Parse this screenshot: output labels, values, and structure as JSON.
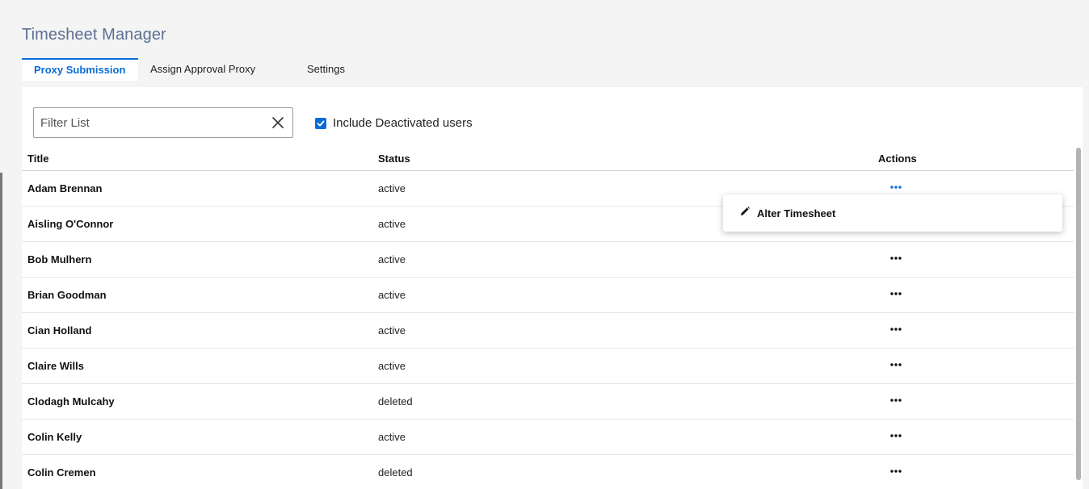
{
  "app": {
    "title": "Timesheet Manager"
  },
  "tabs": [
    {
      "label": "Proxy Submission",
      "active": true
    },
    {
      "label": "Assign Approval Proxy",
      "active": false
    },
    {
      "label": "Settings",
      "active": false
    }
  ],
  "filter": {
    "placeholder": "Filter List",
    "value": "",
    "clear_icon": "close-icon"
  },
  "include_deactivated": {
    "label": "Include Deactivated users",
    "checked": true
  },
  "table": {
    "headers": {
      "title": "Title",
      "status": "Status",
      "actions": "Actions"
    },
    "rows": [
      {
        "title": "Adam Brennan",
        "status": "active"
      },
      {
        "title": "Aisling O'Connor",
        "status": "active"
      },
      {
        "title": "Bob Mulhern",
        "status": "active"
      },
      {
        "title": "Brian Goodman",
        "status": "active"
      },
      {
        "title": "Cian Holland",
        "status": "active"
      },
      {
        "title": "Claire Wills",
        "status": "active"
      },
      {
        "title": "Clodagh Mulcahy",
        "status": "deleted"
      },
      {
        "title": "Colin Kelly",
        "status": "active"
      },
      {
        "title": "Colin Cremen",
        "status": "deleted"
      }
    ]
  },
  "actions_menu": {
    "open_for_row": 0,
    "items": [
      {
        "label": "Alter Timesheet",
        "icon": "pencil-icon"
      }
    ]
  },
  "colors": {
    "accent": "#0a6cd6",
    "title": "#5c6f93",
    "background": "#f4f4f4",
    "panel": "#ffffff"
  }
}
